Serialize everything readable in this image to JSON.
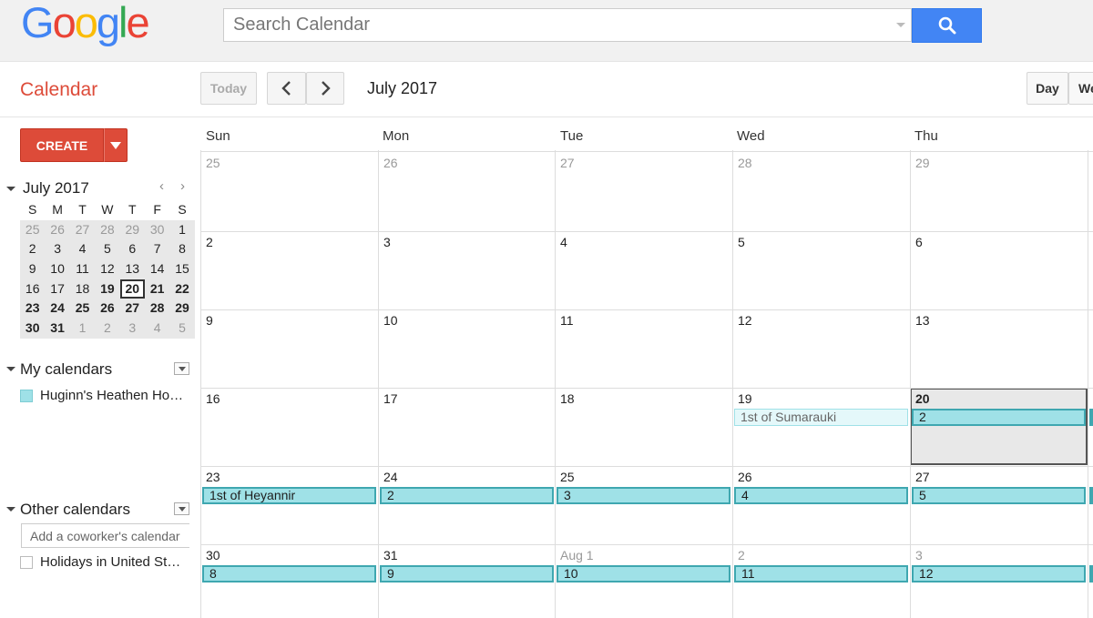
{
  "app": {
    "logo": [
      "G",
      "o",
      "o",
      "g",
      "l",
      "e"
    ],
    "logo_colors": [
      "#4285f4",
      "#ea4335",
      "#fbbc05",
      "#4285f4",
      "#34a853",
      "#ea4335"
    ],
    "title": "Calendar"
  },
  "search": {
    "placeholder": "Search Calendar"
  },
  "toolbar": {
    "today": "Today",
    "month_label": "July 2017",
    "view_day": "Day",
    "view_week": "We"
  },
  "sidebar": {
    "create_label": "CREATE",
    "mini": {
      "title": "July 2017",
      "headers": [
        "S",
        "M",
        "T",
        "W",
        "T",
        "F",
        "S"
      ],
      "weeks": [
        [
          "25",
          "26",
          "27",
          "28",
          "29",
          "30",
          "1"
        ],
        [
          "2",
          "3",
          "4",
          "5",
          "6",
          "7",
          "8"
        ],
        [
          "9",
          "10",
          "11",
          "12",
          "13",
          "14",
          "15"
        ],
        [
          "16",
          "17",
          "18",
          "19",
          "20",
          "21",
          "22"
        ],
        [
          "23",
          "24",
          "25",
          "26",
          "27",
          "28",
          "29"
        ],
        [
          "30",
          "31",
          "1",
          "2",
          "3",
          "4",
          "5"
        ]
      ]
    },
    "my_calendars": {
      "label": "My calendars",
      "items": [
        {
          "label": "Huginn's Heathen Ho…",
          "color": "#9fe1e7"
        }
      ]
    },
    "other_calendars": {
      "label": "Other calendars",
      "add_placeholder": "Add a coworker's calendar",
      "items": [
        {
          "label": "Holidays in United St…"
        }
      ]
    }
  },
  "grid": {
    "days": [
      "Sun",
      "Mon",
      "Tue",
      "Wed",
      "Thu"
    ],
    "weeks": [
      [
        "25",
        "26",
        "27",
        "28",
        "29"
      ],
      [
        "2",
        "3",
        "4",
        "5",
        "6"
      ],
      [
        "9",
        "10",
        "11",
        "12",
        "13"
      ],
      [
        "16",
        "17",
        "18",
        "19",
        "20"
      ],
      [
        "23",
        "24",
        "25",
        "26",
        "27"
      ],
      [
        "30",
        "31",
        "Aug 1",
        "2",
        "3"
      ]
    ],
    "events": {
      "w3": [
        "1st of Sumarauki",
        "2"
      ],
      "w4": [
        "1st of Heyannir",
        "2",
        "3",
        "4",
        "5"
      ],
      "w5": [
        "8",
        "9",
        "10",
        "11",
        "12"
      ]
    },
    "event_color": "#9fe1e7"
  }
}
